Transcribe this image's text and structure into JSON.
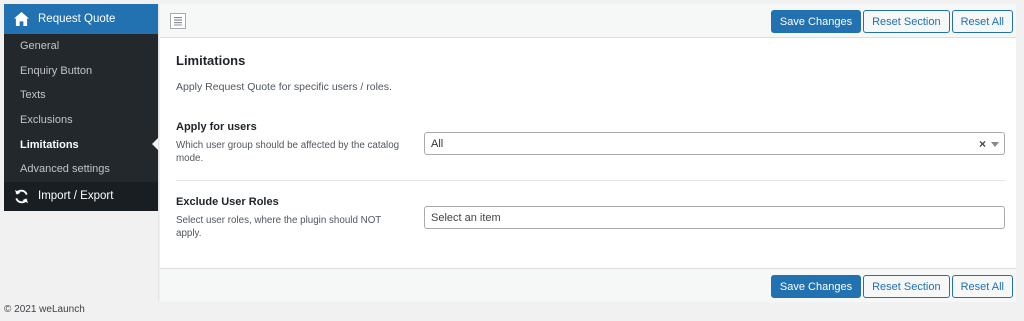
{
  "sidebar": {
    "header": "Request Quote",
    "items": [
      {
        "label": "General"
      },
      {
        "label": "Enquiry Button"
      },
      {
        "label": "Texts"
      },
      {
        "label": "Exclusions"
      },
      {
        "label": "Limitations"
      },
      {
        "label": "Advanced settings"
      }
    ],
    "section": "Import / Export",
    "header_icon": "home-icon",
    "section_icon": "sync-icon"
  },
  "toolbar": {
    "save": "Save Changes",
    "reset_section": "Reset Section",
    "reset_all": "Reset All",
    "expand_icon": "expand-options-icon"
  },
  "main": {
    "title": "Limitations",
    "description": "Apply Request Quote for specific users / roles.",
    "fields": [
      {
        "label": "Apply for users",
        "description": "Which user group should be affected by the catalog mode.",
        "value": "All",
        "clear": "×"
      },
      {
        "label": "Exclude User Roles",
        "description": "Select user roles, where the plugin should NOT apply.",
        "placeholder": "Select an item"
      }
    ]
  },
  "footer": "© 2021 weLaunch",
  "colors": {
    "accent": "#2271b1",
    "sidebar_bg": "#23282d",
    "sidebar_section_bg": "#191e23"
  }
}
